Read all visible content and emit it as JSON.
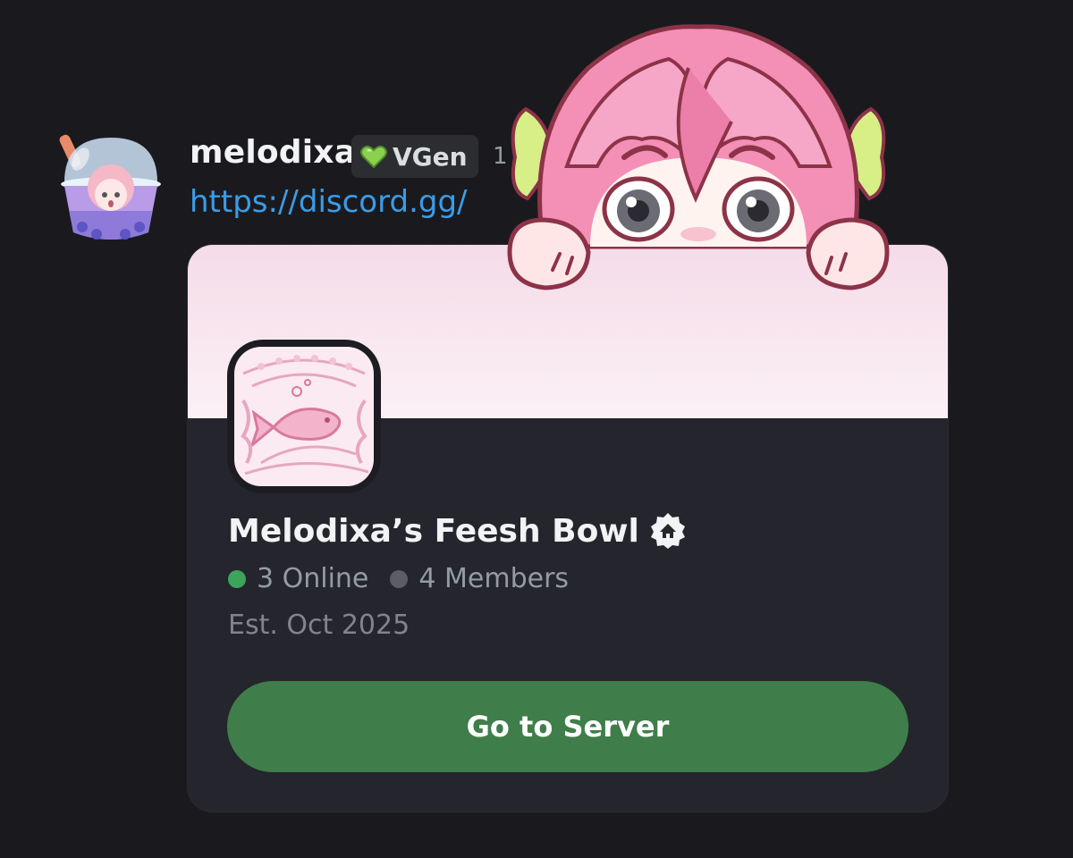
{
  "message": {
    "username": "melodixa",
    "tag": {
      "label": "VGen",
      "icon": "green-heart-icon"
    },
    "timestamp": "1",
    "link": "https://discord.gg/"
  },
  "invite": {
    "server_name": "Melodixa’s Feesh Bowl",
    "online": "3 Online",
    "members": "4 Members",
    "established": "Est. Oct 2025",
    "button_label": "Go to Server",
    "badge_icon": "community-home-badge-icon",
    "banner_color": "#f5dbe8"
  },
  "colors": {
    "background": "#1a1a1e",
    "card": "#25252d",
    "link": "#3a9ce8",
    "button": "#3f7e4a",
    "online_dot": "#3ba55c",
    "members_dot": "#5c5e66"
  }
}
